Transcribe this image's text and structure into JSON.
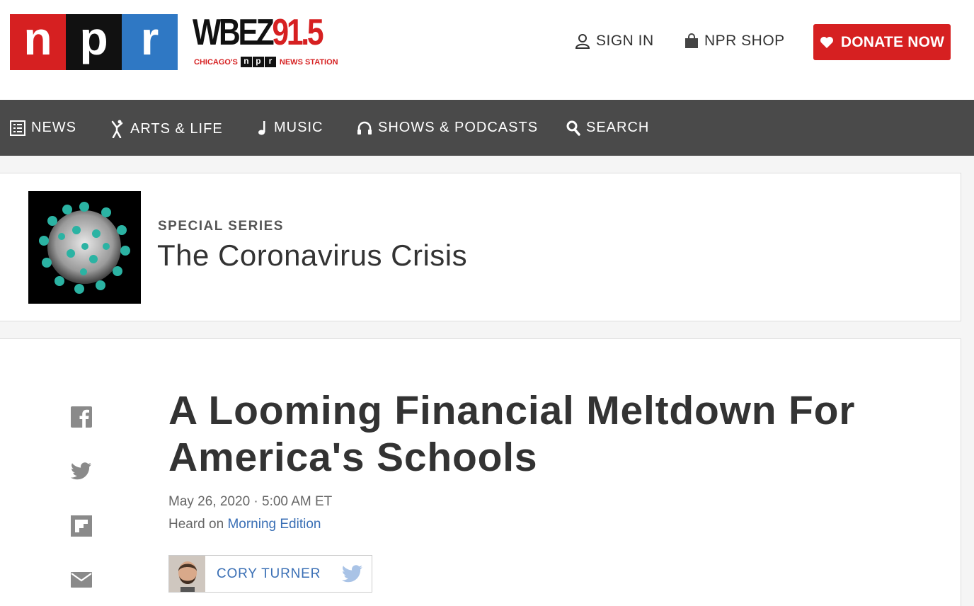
{
  "header": {
    "logo_letters": [
      "n",
      "p",
      "r"
    ],
    "station_callsign": "WBEZ",
    "station_frequency": "91.5",
    "station_tag_left": "CHICAGO'S",
    "station_tag_mid": [
      "n",
      "p",
      "r"
    ],
    "station_tag_right": "NEWS STATION",
    "sign_in": "SIGN IN",
    "shop": "NPR SHOP",
    "donate": "DONATE NOW"
  },
  "nav": {
    "items": [
      {
        "label": "NEWS",
        "icon": "news-icon"
      },
      {
        "label": "ARTS & LIFE",
        "icon": "arts-icon"
      },
      {
        "label": "MUSIC",
        "icon": "music-note-icon"
      },
      {
        "label": "SHOWS & PODCASTS",
        "icon": "headphones-icon"
      },
      {
        "label": "SEARCH",
        "icon": "search-icon"
      }
    ]
  },
  "series": {
    "kicker": "SPECIAL SERIES",
    "title": "The Coronavirus Crisis"
  },
  "article": {
    "headline": "A Looming Financial Meltdown For America's Schools",
    "dateline": "May 26, 2020 · 5:00 AM ET",
    "heard_on_prefix": "Heard on ",
    "heard_on_program": "Morning Edition",
    "author": "CORY TURNER",
    "share_icons": [
      "facebook-icon",
      "twitter-icon",
      "flipboard-icon",
      "email-icon"
    ]
  },
  "colors": {
    "npr_red": "#d62021",
    "npr_black": "#111111",
    "npr_blue": "#2f78c4",
    "nav_bg": "#4a4a4a",
    "link_blue": "#3a6fb5"
  }
}
